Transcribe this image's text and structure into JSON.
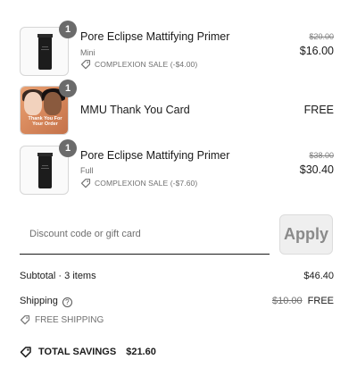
{
  "items": [
    {
      "quantity": "1",
      "name": "Pore Eclipse Mattifying Primer",
      "variant": "Mini",
      "discount": "COMPLEXION SALE (-$4.00)",
      "original_price": "$20.00",
      "price": "$16.00"
    },
    {
      "quantity": "1",
      "name": "MMU Thank You Card",
      "card_text": "Thank You For Your Order",
      "price": "FREE"
    },
    {
      "quantity": "1",
      "name": "Pore Eclipse Mattifying Primer",
      "variant": "Full",
      "discount": "COMPLEXION SALE (-$7.60)",
      "original_price": "$38.00",
      "price": "$30.40"
    }
  ],
  "discount": {
    "placeholder": "Discount code or gift card",
    "value": "",
    "apply_label": "Apply"
  },
  "summary": {
    "subtotal_label": "Subtotal · 3 items",
    "subtotal_value": "$46.40",
    "shipping_label": "Shipping",
    "shipping_original": "$10.00",
    "shipping_value": "FREE",
    "shipping_discount": "FREE SHIPPING",
    "savings_label": "TOTAL SAVINGS",
    "savings_value": "$21.60"
  },
  "icons": {
    "tag": "tag-icon",
    "help": "question-circle-icon",
    "savings": "tag-icon"
  },
  "colors": {
    "badge": "#6b6b6b",
    "muted_text": "#707070",
    "apply_bg": "#efefef",
    "primer_tube": "#1c1c1c"
  }
}
